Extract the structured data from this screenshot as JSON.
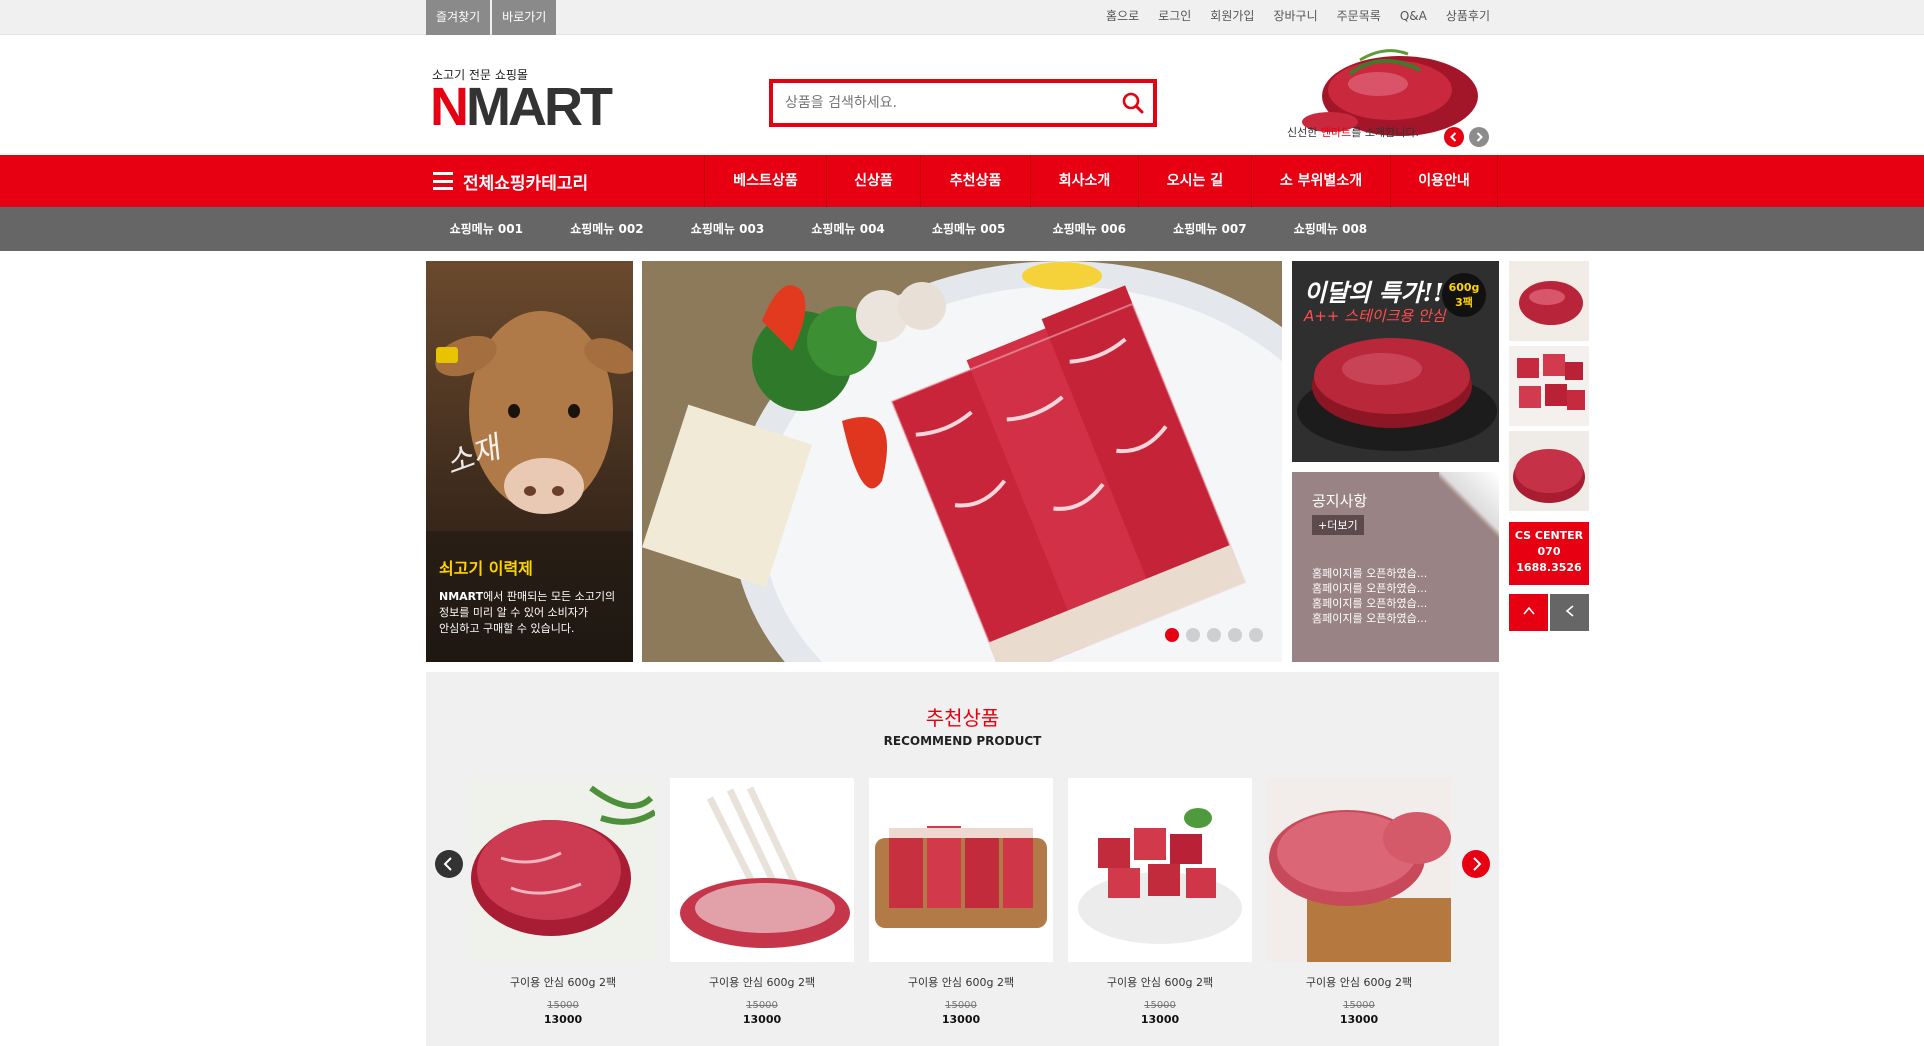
{
  "quick_links": [
    "즐겨찾기",
    "바로가기"
  ],
  "top_links": [
    "홈으로",
    "로그인",
    "회원가입",
    "장바구니",
    "주문목록",
    "Q&A",
    "상품후기"
  ],
  "brand": {
    "tagline": "소고기 전문 쇼핑몰",
    "logo_n": "N",
    "logo_rest": "MART"
  },
  "search": {
    "placeholder": "상품을 검색하세요."
  },
  "header_banner": {
    "caption_pre": "신선한 ",
    "caption_highlight": "엔마트",
    "caption_post": "를 소개합니다."
  },
  "main_nav": {
    "all_category": "전체쇼핑카테고리",
    "items": [
      "베스트상품",
      "신상품",
      "추천상품",
      "회사소개",
      "오시는 길",
      "소 부위별소개",
      "이용안내"
    ]
  },
  "sub_nav": [
    "쇼핑메뉴 001",
    "쇼핑메뉴 002",
    "쇼핑메뉴 003",
    "쇼핑메뉴 004",
    "쇼핑메뉴 005",
    "쇼핑메뉴 006",
    "쇼핑메뉴 007",
    "쇼핑메뉴 008"
  ],
  "traceability": {
    "script": "소재",
    "title": "쇠고기 이력제",
    "brand": "NMART",
    "line1": "에서 판매되는 모든 소고기의",
    "line2": "정보를 미리 알 수 있어 소비자가",
    "line3": "안심하고 구매할 수 있습니다."
  },
  "hero_slider": {
    "dot_count": 5,
    "active_index": 0
  },
  "promo": {
    "title": "이달의 특가!!",
    "subtitle": "A++ 스테이크용 안심",
    "badge_top": "600g",
    "badge_bottom": "3팩"
  },
  "notice": {
    "title": "공지사항",
    "more": "+더보기",
    "items": [
      "홈페이지를 오픈하였습...",
      "홈페이지를 오픈하였습...",
      "홈페이지를 오픈하였습...",
      "홈페이지를 오픈하였습..."
    ]
  },
  "cs_center": {
    "label": "CS CENTER",
    "phone_1": "070",
    "phone_2": "1688.3526"
  },
  "recommend": {
    "title": "추천상품",
    "subtitle": "RECOMMEND PRODUCT",
    "products": [
      {
        "name": "구이용 안심 600g 2팩",
        "old_price": "15000",
        "price": "13000"
      },
      {
        "name": "구이용 안심 600g 2팩",
        "old_price": "15000",
        "price": "13000"
      },
      {
        "name": "구이용 안심 600g 2팩",
        "old_price": "15000",
        "price": "13000"
      },
      {
        "name": "구이용 안심 600g 2팩",
        "old_price": "15000",
        "price": "13000"
      },
      {
        "name": "구이용 안심 600g 2팩",
        "old_price": "15000",
        "price": "13000"
      }
    ]
  },
  "colors": {
    "accent": "#e60012",
    "subnav": "#666666",
    "topbar": "#f0f0f0",
    "notice_bg": "#9a8385",
    "promo_badge_text": "#ffd400"
  }
}
